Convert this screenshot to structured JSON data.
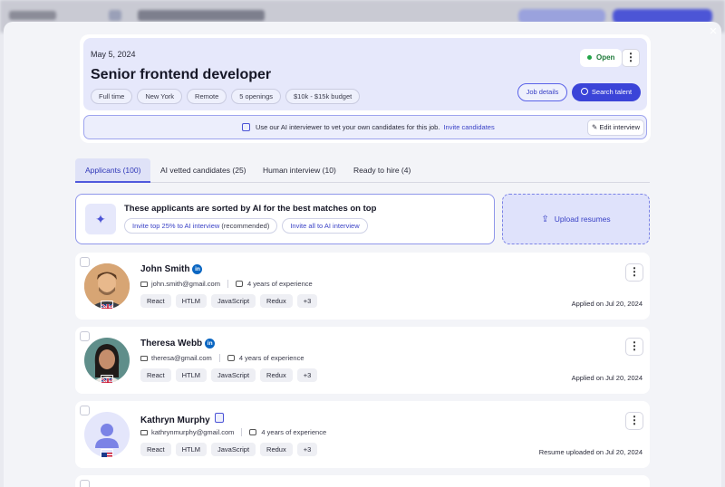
{
  "background": {
    "close_label": "×"
  },
  "job": {
    "date": "May 5, 2024",
    "title": "Senior frontend developer",
    "tags": [
      "Full time",
      "New York",
      "Remote",
      "5 openings",
      "$10k - $15k budget"
    ],
    "status": "Open",
    "more_icon": "⋮",
    "details_button": "Job details",
    "search_button": "Search talent",
    "ai_bar": {
      "text": "Use our AI interviewer to vet your own candidates for this job.",
      "link": "Invite candidates",
      "edit_button": "Edit interview",
      "edit_icon": "✎"
    }
  },
  "tabs": [
    {
      "label": "Applicants (100)",
      "active": true
    },
    {
      "label": "AI vetted candidates (25)",
      "active": false
    },
    {
      "label": "Human interview (10)",
      "active": false
    },
    {
      "label": "Ready to hire (4)",
      "active": false
    }
  ],
  "sort_card": {
    "title": "These applicants are sorted by AI for the best matches on top",
    "wand_icon": "✦",
    "invite_top_link": "Invite top 25% to AI interview",
    "invite_top_note": "(recommended)",
    "invite_all": "Invite all to AI interview"
  },
  "upload": {
    "label": "Upload resumes",
    "icon": "⇪"
  },
  "applicants": [
    {
      "name": "John Smith",
      "email": "john.smith@gmail.com",
      "experience": "4 years of experience",
      "skills": [
        "React",
        "HTLM",
        "JavaScript",
        "Redux",
        "+3"
      ],
      "applied": "Applied on Jul 20, 2024",
      "source_badge": "in",
      "flag": "uk"
    },
    {
      "name": "Theresa Webb",
      "email": "theresa@gmail.com",
      "experience": "4 years of experience",
      "skills": [
        "React",
        "HTLM",
        "JavaScript",
        "Redux",
        "+3"
      ],
      "applied": "Applied on Jul 20, 2024",
      "source_badge": "in",
      "flag": "uk"
    },
    {
      "name": "Kathryn Murphy",
      "email": "kathrynmurphy@gmail.com",
      "experience": "4 years of experience",
      "skills": [
        "React",
        "HTLM",
        "JavaScript",
        "Redux",
        "+3"
      ],
      "applied": "Resume uploaded on Jul 20, 2024",
      "source_badge": "resume",
      "flag": "us"
    }
  ]
}
